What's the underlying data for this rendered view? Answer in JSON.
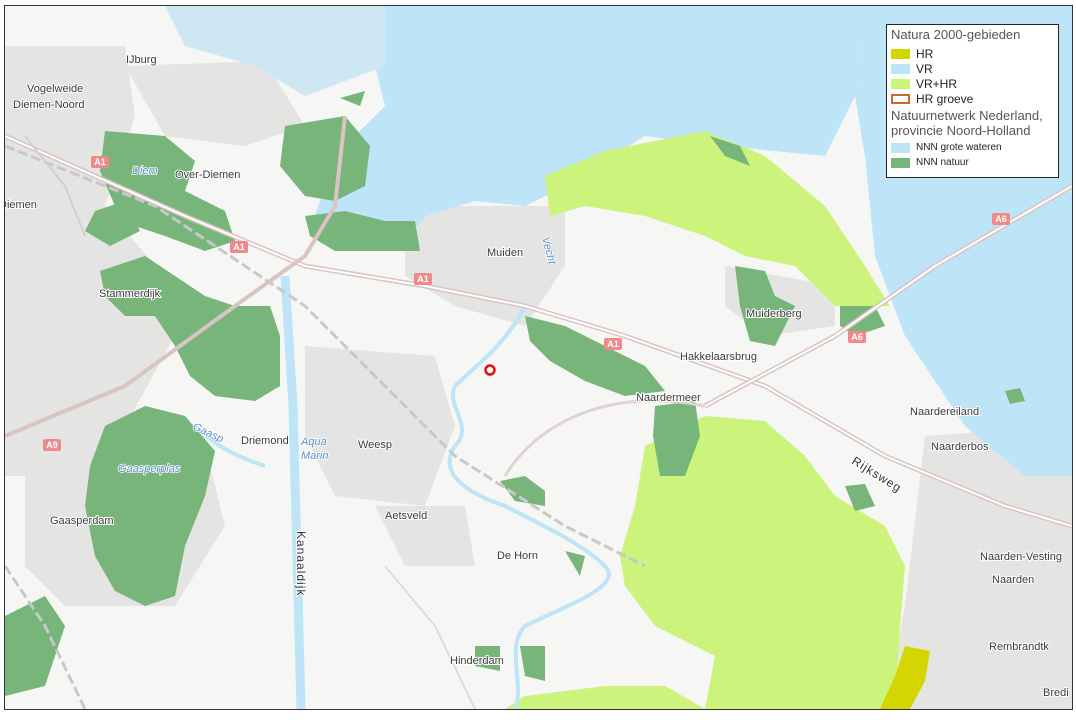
{
  "legend": {
    "title": "Natura 2000-gebieden",
    "items": [
      {
        "label": "HR",
        "color": "#d4d600"
      },
      {
        "label": "VR",
        "color": "#bde4f7"
      },
      {
        "label": "VR+HR",
        "color": "#ccf47c"
      },
      {
        "label": "HR groeve",
        "color": "#ffffff",
        "border": "#c9692a"
      }
    ],
    "subtitle_line1": "Natuurnetwerk Nederland,",
    "subtitle_line2": "provincie Noord-Holland",
    "nnn_items": [
      {
        "label": "NNN grote wateren",
        "color": "#bde4f7"
      },
      {
        "label": "NNN natuur",
        "color": "#77b57a"
      }
    ]
  },
  "places": {
    "ijburg": "IJburg",
    "vogelweide": "Vogelweide",
    "diemen_noord": "Diemen-Noord",
    "over_diemen": "Over-Diemen",
    "diemen": "Diemen",
    "stammerdijk": "Stammerdijk",
    "muiden": "Muiden",
    "muiderberg": "Muiderberg",
    "hakkelaarsbrug": "Hakkelaarsbrug",
    "naardermeer": "Naardermeer",
    "naardereiland": "Naardereiland",
    "naarderbos": "Naarderbos",
    "driemond": "Driemond",
    "weesp": "Weesp",
    "gaasperdam": "Gaasperdam",
    "aetsveld": "Aetsveld",
    "de_horn": "De Horn",
    "hinderdam": "Hinderdam",
    "naarden_vesting": "Naarden-Vesting",
    "naarden": "Naarden",
    "rembrandtk": "Rembrandtk",
    "bredi": "Bredi"
  },
  "water_labels": {
    "vecht": "Vecht",
    "gaasp": "Gaasp",
    "aqua": "Aqua",
    "marin": "Marin",
    "gaasperplas": "Gaasperplas",
    "diemer": "Diem"
  },
  "roads": {
    "kanaaldijk": "Kanaaldijk",
    "rijksweg": "Rijksweg"
  },
  "shields": {
    "a1": "A1",
    "a6": "A6",
    "a9": "A9"
  },
  "colors": {
    "water": "#bde4f7",
    "nnn_natuur": "#77b57a",
    "vr_hr": "#ccf47c",
    "hr": "#d4d600",
    "urban": "#e6e6e4",
    "shield": "#f08a8a",
    "marker": "#e01010"
  }
}
